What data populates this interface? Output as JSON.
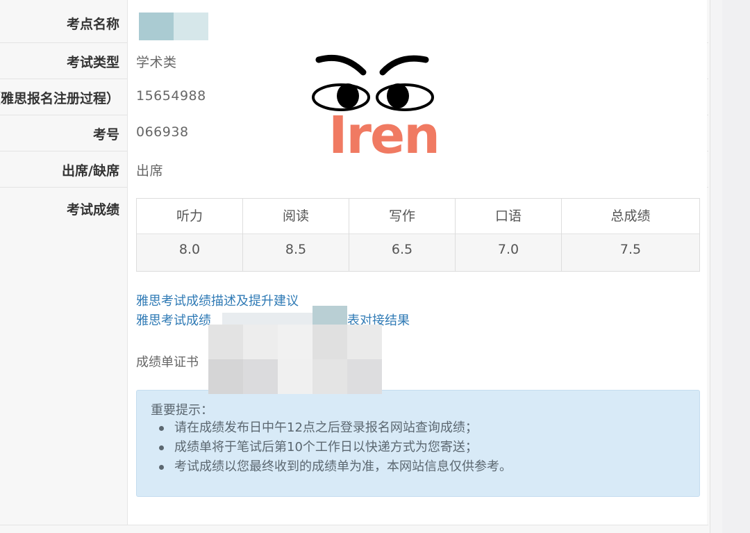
{
  "rows": {
    "site_name": {
      "label": "考点名称",
      "value": ""
    },
    "exam_type": {
      "label": "考试类型",
      "value": "学术类"
    },
    "registration": {
      "label": "（雅思报名注册过程）",
      "value": "15654988"
    },
    "candidate_no": {
      "label": "考号",
      "value": "066938"
    },
    "attendance": {
      "label": "出席/缺席",
      "value": "出席"
    },
    "results": {
      "label": "考试成绩"
    }
  },
  "scores": {
    "headers": [
      "听力",
      "阅读",
      "写作",
      "口语",
      "总成绩"
    ],
    "values": [
      "8.0",
      "8.5",
      "6.5",
      "7.0",
      "7.5"
    ]
  },
  "links": {
    "advice": "雅思考试成绩描述及提升建议",
    "cefr_visible_start": "雅思考试成绩",
    "cefr_visible_end": "级量表对接结果"
  },
  "certificate_label": "成绩单证书",
  "notice": {
    "title": "重要提示：",
    "items": [
      "请在成绩发布日中午12点之后登录报名网站查询成绩；",
      "成绩单将于笔试后第10个工作日以快递方式为您寄送；",
      "考试成绩以您最终收到的成绩单为准，本网站信息仅供参考。"
    ]
  },
  "watermark": {
    "text": "Iren"
  },
  "colors": {
    "link": "#2f7ab5",
    "notice_bg": "#d8eaf7",
    "watermark": "#f07a62"
  }
}
